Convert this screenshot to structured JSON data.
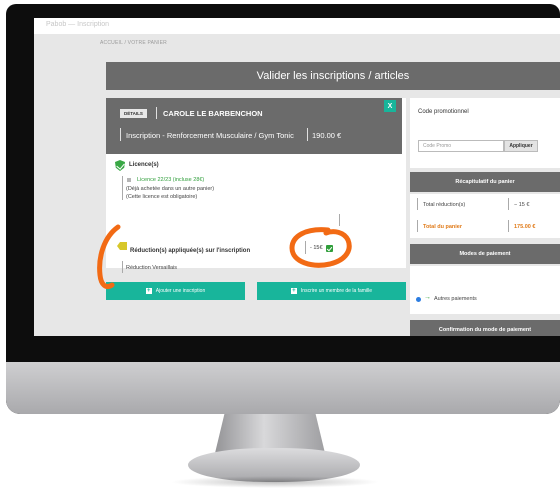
{
  "topbar": {
    "text": "Pabob — Inscription"
  },
  "breadcrumb": {
    "home": "ACCUEIL",
    "separator": "/",
    "current": "VOTRE PANIER"
  },
  "banner": {
    "title": "Valider les inscriptions / articles"
  },
  "card": {
    "details_tag": "DÉTAILS",
    "member_name": "CAROLE LE BARBENCHON",
    "close": "X",
    "inscription_title": "Inscription - Renforcement Musculaire / Gym Tonic",
    "price": "190.00 €"
  },
  "licence": {
    "title": "Licence(s)",
    "line": "Licence 22/23 (incluse 28€)",
    "note1": "(Déjà achetée dans un autre panier)",
    "note2": "(Cette licence est obligatoire)"
  },
  "reductions": {
    "title": "Réduction(s) appliquée(s) sur l'inscription",
    "name": "Réduction Versaillais",
    "value": "- 15€"
  },
  "buttons": {
    "add_inscription": "Ajouter une inscription",
    "add_family_member": "Inscrire un membre de la famille"
  },
  "sidebar": {
    "promo_label": "Code promotionnel",
    "promo_placeholder": "Code Promo",
    "apply_label": "Appliquer",
    "recap_header": "Récapitulatif du panier",
    "total_reduction_label": "Total réduction(s)",
    "total_reduction_value": "− 15 €",
    "total_label": "Total du panier",
    "total_value": "175.00 €",
    "payment_header": "Modes de paiement",
    "payment_option": "Autres paiements",
    "confirmation_header": "Confirmation du mode de paiement"
  },
  "colors": {
    "accent": "#18b59b",
    "header_grey": "#6b6b6b",
    "annotation_orange": "#f26a14",
    "success_green": "#2f9e3a"
  }
}
